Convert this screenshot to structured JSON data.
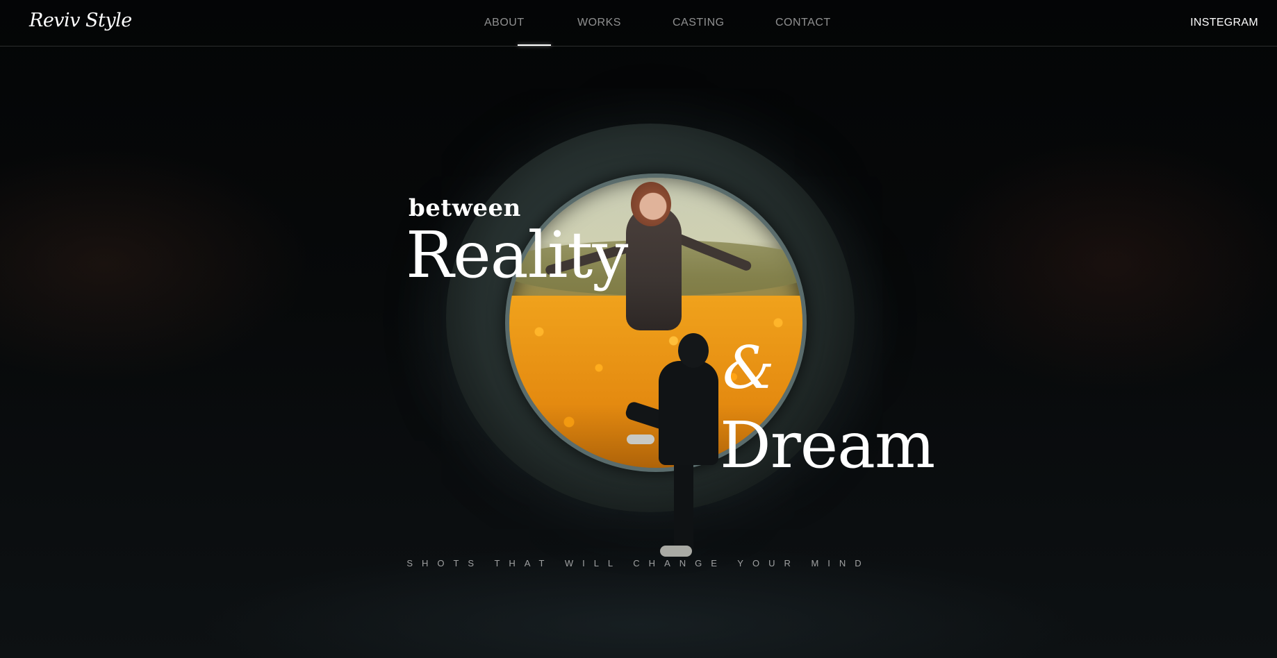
{
  "brand": {
    "logo_text": "Reviv Style"
  },
  "nav": {
    "items": [
      {
        "label": "ABOUT"
      },
      {
        "label": "WORKS"
      },
      {
        "label": "CASTING"
      },
      {
        "label": "CONTACT"
      }
    ],
    "active_index": 0,
    "external_link": "INSTEGRAM"
  },
  "hero": {
    "line1": "between",
    "line2": "Reality",
    "amp": "&",
    "line3": "Dream",
    "tagline": "SHOTS THAT WILL CHANGE YOUR MIND"
  },
  "colors": {
    "background": "#050607",
    "text": "#ffffff",
    "nav_inactive": "#8c8c8c",
    "accent_flowers": "#f2a51d"
  }
}
